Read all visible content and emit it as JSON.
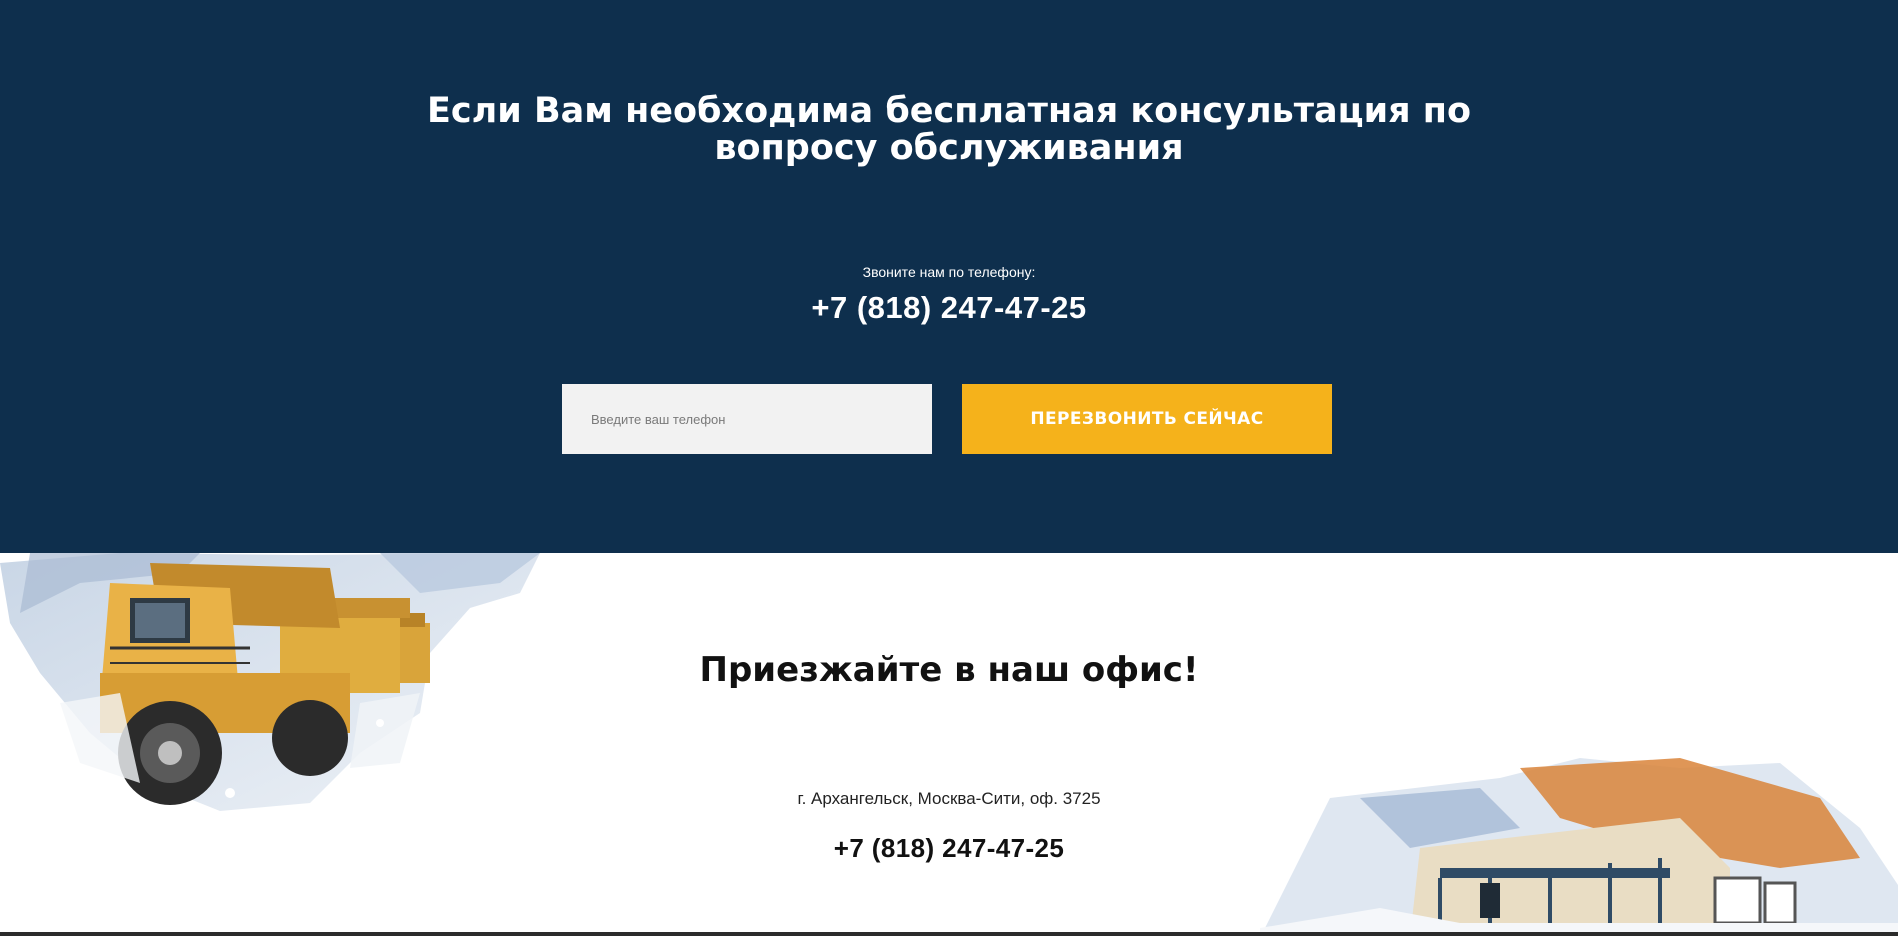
{
  "consultation": {
    "title_line1": "Если Вам необходима бесплатная консультация по",
    "title_line2": "вопросу обслуживания",
    "call_caption": "Звоните нам по телефону:",
    "phone": "+7 (818) 247-47-25",
    "input_placeholder": "Введите ваш телефон",
    "button_label": "ПЕРЕЗВОНИТЬ СЕЙЧАС",
    "colors": {
      "background": "#0e2f4d",
      "button": "#f5b21b",
      "input": "#f2f2f2"
    }
  },
  "office": {
    "title": "Приезжайте в наш офис!",
    "address": "г. Архангельск, Москва-Сити, оф. 3725",
    "phone": "+7 (818) 247-47-25"
  },
  "images": {
    "left": "mining-dump-trucks-in-snow",
    "right": "mining-truck-cabin-in-snow"
  }
}
